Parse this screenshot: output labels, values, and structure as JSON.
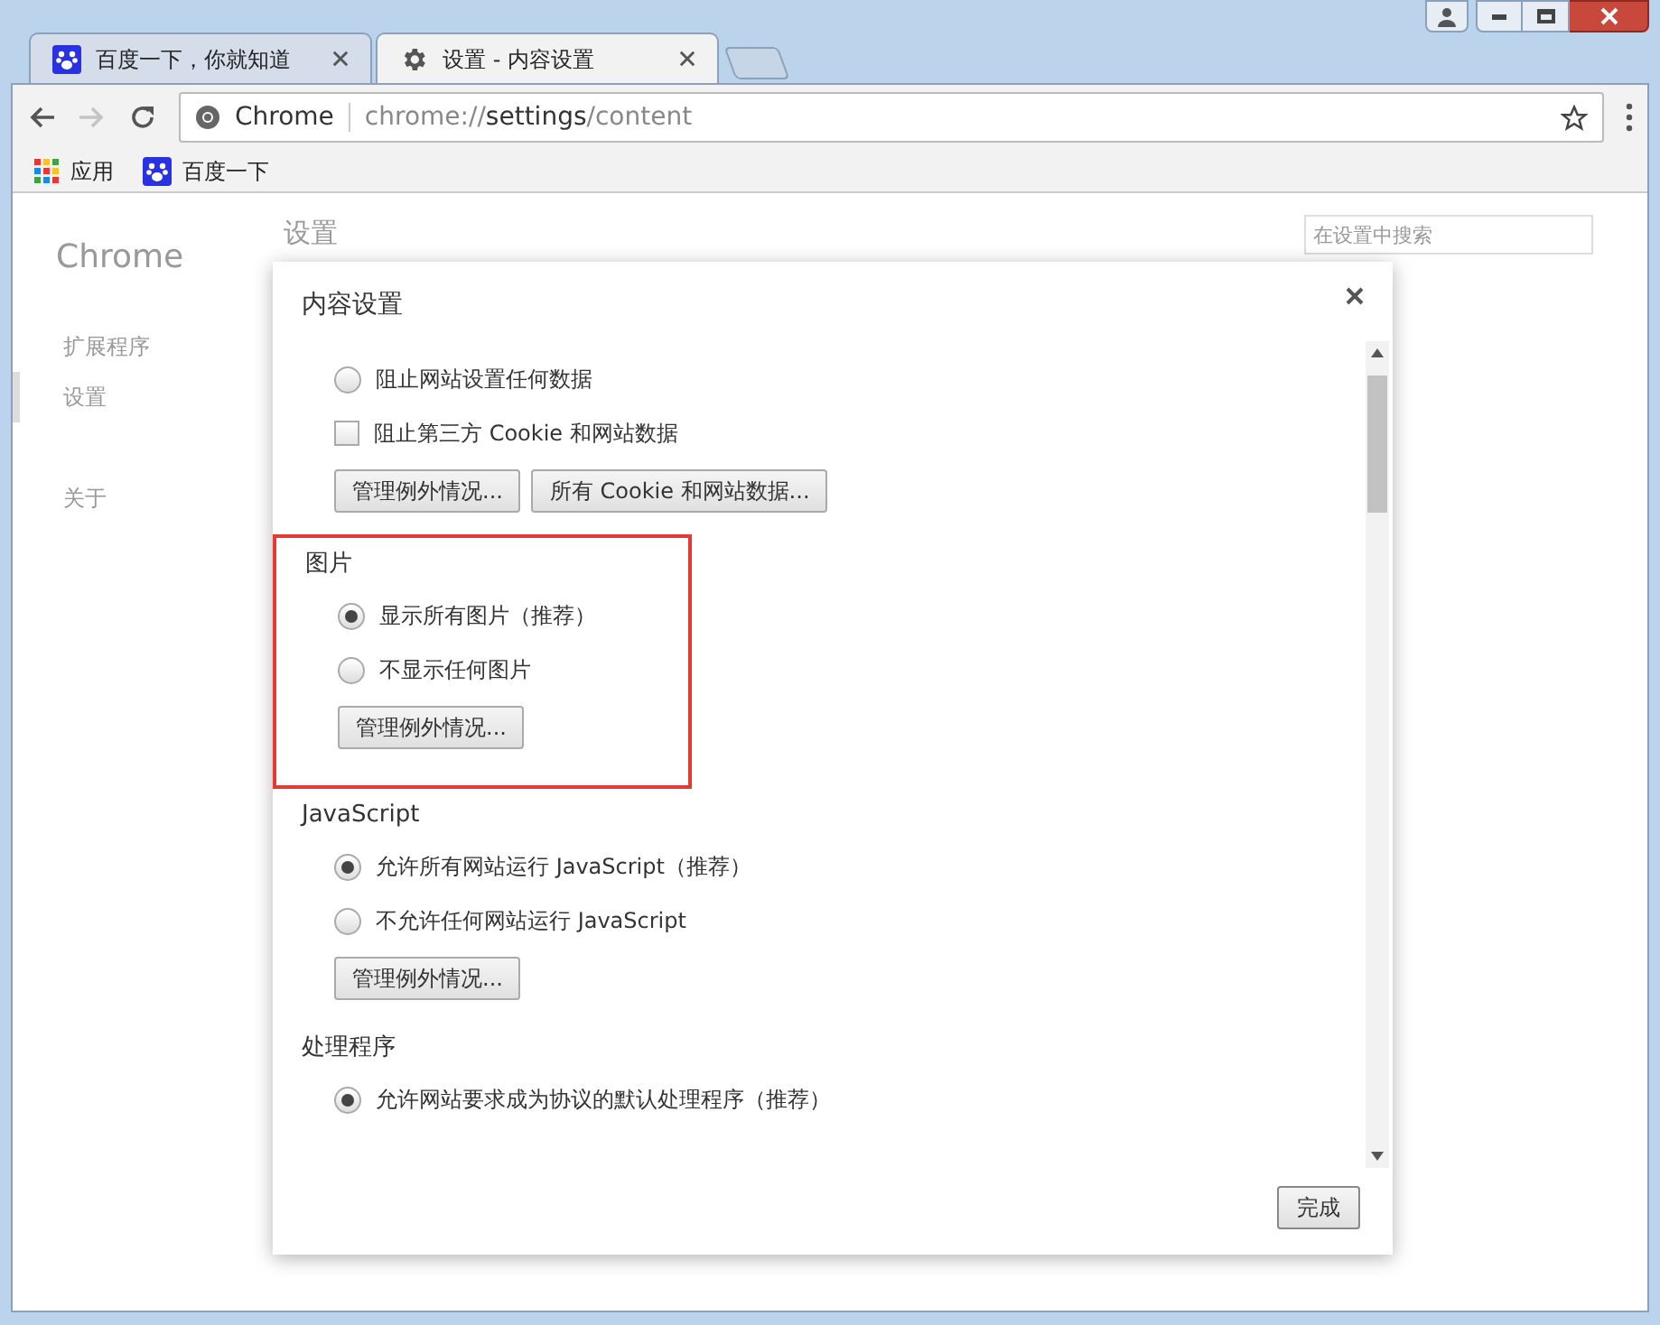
{
  "tabs": [
    {
      "title": "百度一下，你就知道",
      "kind": "paw",
      "selected": false
    },
    {
      "title": "设置 - 内容设置",
      "kind": "gear",
      "selected": true
    }
  ],
  "address": {
    "site_label": "Chrome",
    "scheme": "chrome://",
    "host": "settings",
    "path": "/content"
  },
  "bookmarks": [
    {
      "label": "应用",
      "kind": "apps"
    },
    {
      "label": "百度一下",
      "kind": "paw"
    }
  ],
  "page": {
    "brand": "Chrome",
    "heading": "设置",
    "search_placeholder": "在设置中搜索",
    "nav": [
      {
        "label": "扩展程序",
        "selected": false
      },
      {
        "label": "设置",
        "selected": true
      },
      {
        "label": "关于",
        "selected": false
      }
    ]
  },
  "dialog": {
    "title": "内容设置",
    "done": "完成",
    "sections": [
      {
        "options": [
          {
            "kind": "radio",
            "label": "阻止网站设置任何数据",
            "checked": false
          },
          {
            "kind": "checkbox",
            "label": "阻止第三方 Cookie 和网站数据",
            "checked": false
          }
        ],
        "buttons": [
          "管理例外情况...",
          "所有 Cookie 和网站数据..."
        ]
      },
      {
        "heading": "图片",
        "highlighted": true,
        "options": [
          {
            "kind": "radio",
            "label": "显示所有图片（推荐）",
            "checked": true
          },
          {
            "kind": "radio",
            "label": "不显示任何图片",
            "checked": false
          }
        ],
        "buttons": [
          "管理例外情况..."
        ]
      },
      {
        "heading": "JavaScript",
        "options": [
          {
            "kind": "radio",
            "label": "允许所有网站运行 JavaScript（推荐）",
            "checked": true
          },
          {
            "kind": "radio",
            "label": "不允许任何网站运行 JavaScript",
            "checked": false
          }
        ],
        "buttons": [
          "管理例外情况..."
        ]
      },
      {
        "heading": "处理程序",
        "options": [
          {
            "kind": "radio",
            "label": "允许网站要求成为协议的默认处理程序（推荐）",
            "checked": true
          }
        ]
      }
    ]
  }
}
